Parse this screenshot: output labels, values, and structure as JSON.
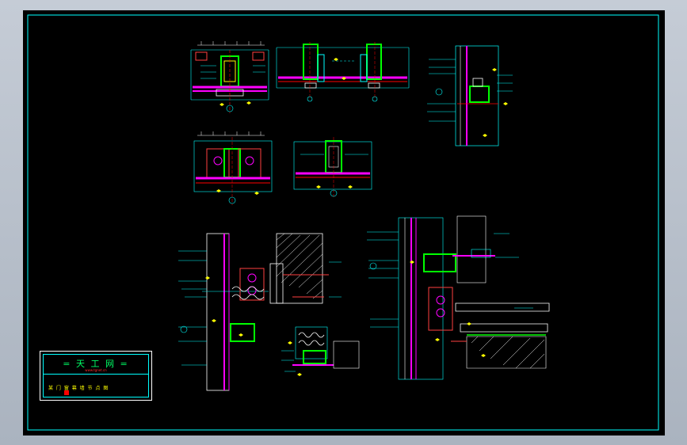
{
  "drawing": {
    "title_block": {
      "logo_text": "= 天 工 网 =",
      "website": "www.tgnet.cn",
      "drawing_name": "某 门 窗 幕 墙 节 点 图"
    },
    "colors": {
      "background": "#000000",
      "frame": "#00ffff",
      "mullion": "#00ff00",
      "glass": "#ff00ff",
      "dimension": "#00ffff",
      "annotation": "#00ffff",
      "hatch": "#ffffff",
      "seal": "#ff0000",
      "marker": "#ffff00"
    }
  }
}
